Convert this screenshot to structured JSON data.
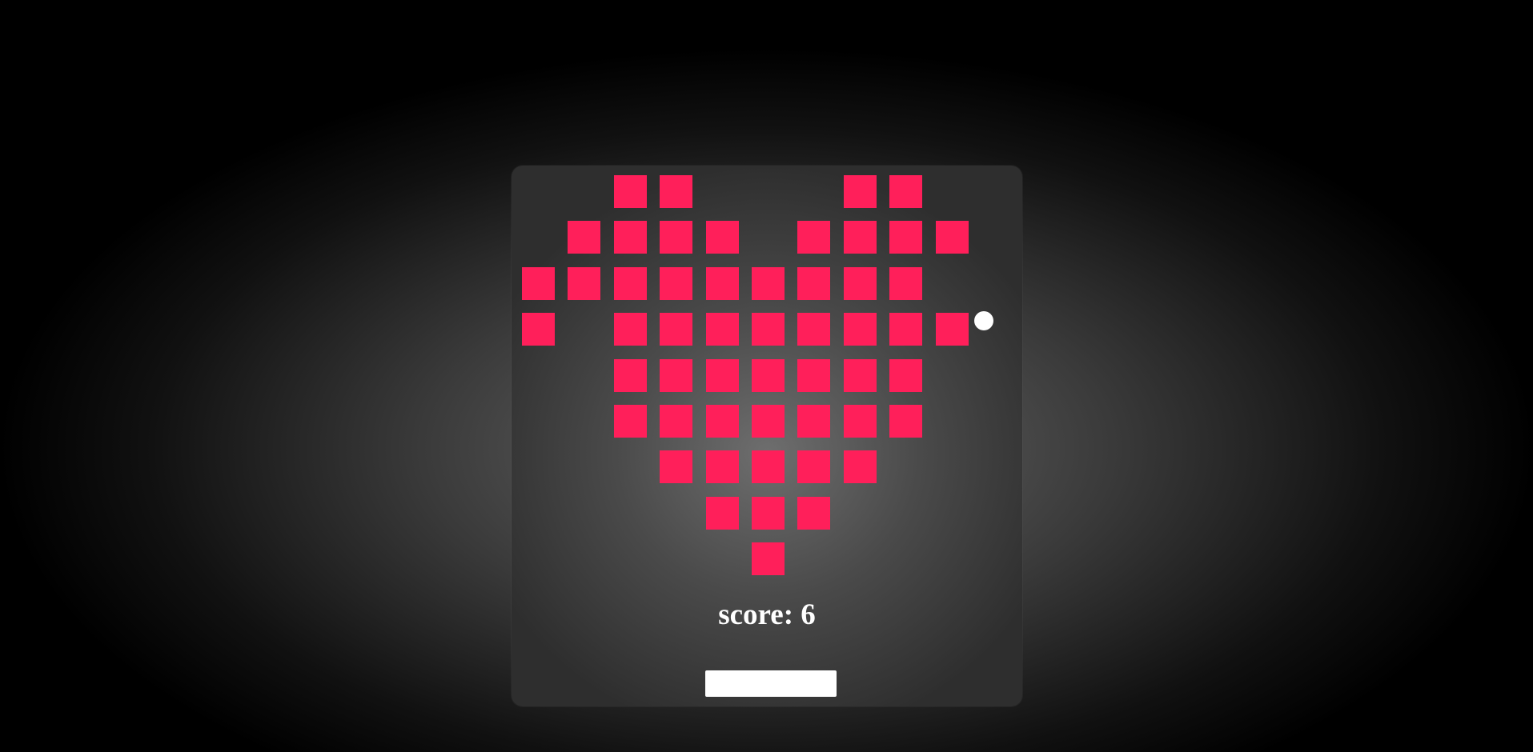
{
  "game": {
    "score_label": "score:",
    "score_value": "6",
    "brick_color": "#ff1f5a",
    "ball_color": "#ffffff",
    "paddle_color": "#ffffff",
    "bricks": [
      [
        0,
        0,
        1,
        1,
        0,
        0,
        0,
        1,
        1,
        0
      ],
      [
        0,
        1,
        1,
        1,
        1,
        0,
        1,
        1,
        1,
        1
      ],
      [
        1,
        1,
        1,
        1,
        1,
        1,
        1,
        1,
        1,
        0
      ],
      [
        1,
        0,
        1,
        1,
        1,
        1,
        1,
        1,
        1,
        1
      ],
      [
        0,
        0,
        1,
        1,
        1,
        1,
        1,
        1,
        1,
        0
      ],
      [
        0,
        0,
        1,
        1,
        1,
        1,
        1,
        1,
        1,
        0
      ],
      [
        0,
        0,
        0,
        1,
        1,
        1,
        1,
        1,
        0,
        0
      ],
      [
        0,
        0,
        0,
        0,
        1,
        1,
        1,
        0,
        0,
        0
      ],
      [
        0,
        0,
        0,
        0,
        0,
        1,
        0,
        0,
        0,
        0
      ]
    ]
  }
}
